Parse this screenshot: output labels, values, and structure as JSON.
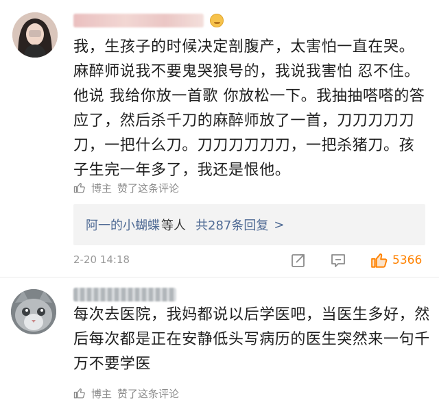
{
  "comments": [
    {
      "text": "我，生孩子的时候决定剖腹产，太害怕一直在哭。麻醉师说我不要鬼哭狼号的，我说我害怕 忍不住。他说 我给你放一首歌 你放松一下。我抽抽嗒嗒的答应了，然后杀千刀的麻醉师放了一首，刀刀刀刀刀刀，一把什么刀。刀刀刀刀刀刀，一把杀猪刀。孩子生完一年多了，我还是恨他。",
      "author_like": {
        "author": "博主",
        "action": "赞了这条评论"
      },
      "replies": {
        "names": "阿一的小蝴蝶",
        "suffix": "等人",
        "count": "共287条回复",
        "chevron": ">"
      },
      "timestamp": "2-20 14:18",
      "likes": "5366",
      "icons": {
        "share": "share-icon",
        "comment": "comment-icon",
        "like": "thumbs-up-icon"
      },
      "accent": "#ff8200"
    },
    {
      "text": "每次去医院，我妈都说以后学医吧，当医生多好，然后每次都是正在安静低头写病历的医生突然来一句千万不要学医",
      "author_like": {
        "author": "博主",
        "action": "赞了这条评论"
      }
    }
  ],
  "colors": {
    "link": "#506b95",
    "muted": "#8b8b8b",
    "reply_bg": "#f3f3f3"
  }
}
